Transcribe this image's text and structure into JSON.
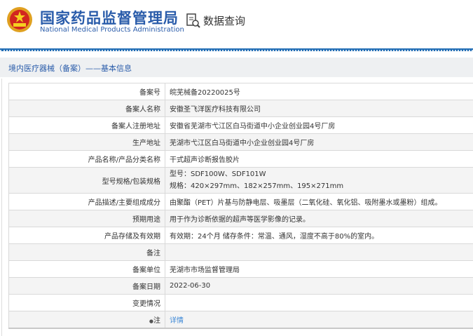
{
  "header": {
    "title_cn": "国家药品监督管理局",
    "title_en": "National Medical Products Administration",
    "query_label": "数据查询"
  },
  "section_title": "境内医疗器械（备案）——基本信息",
  "rows": [
    {
      "label": "备案号",
      "value": "皖芜械备20220025号"
    },
    {
      "label": "备案人名称",
      "value": "安徽圣飞洋医疗科技有限公司"
    },
    {
      "label": "备案人注册地址",
      "value": "安徽省芜湖市弋江区白马街道中小企业创业园4号厂房"
    },
    {
      "label": "生产地址",
      "value": "芜湖市弋江区白马街道中小企业创业园4号厂房"
    },
    {
      "label": "产品名称/产品分类名称",
      "value": "干式超声诊断报告胶片"
    },
    {
      "label": "型号规格/包装规格",
      "value": "型号：SDF100W、SDF101W",
      "value2": "规格：420×297mm、182×257mm、195×271mm"
    },
    {
      "label": "产品描述/主要组成成分",
      "value": "由聚酯（PET）片基与防静电层、吸墨层（二氧化硅、氧化铝、吸附墨水或墨粉）组成。"
    },
    {
      "label": "预期用途",
      "value": "用于作为诊断依据的超声等医学影像的记录。"
    },
    {
      "label": "产品存储及有效期",
      "value": "有效期：24个月 储存条件：常温、通风，湿度不高于80%的室内。"
    },
    {
      "label": "备注",
      "value": ""
    },
    {
      "label": "备案单位",
      "value": "芜湖市市场监督管理局"
    },
    {
      "label": "备案日期",
      "value": "2022-06-30"
    },
    {
      "label": "变更情况",
      "value": ""
    },
    {
      "label": "注",
      "value": "详情"
    }
  ]
}
